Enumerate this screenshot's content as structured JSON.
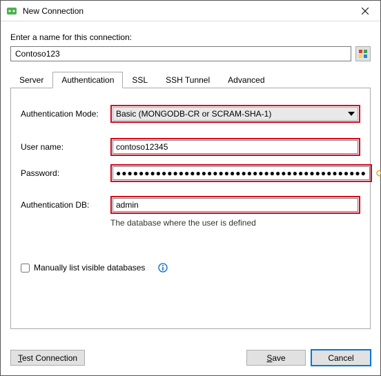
{
  "window": {
    "title": "New Connection"
  },
  "prompt": "Enter a name for this connection:",
  "connection_name": "Contoso123",
  "tabs": {
    "server": "Server",
    "authentication": "Authentication",
    "ssl": "SSL",
    "ssh": "SSH Tunnel",
    "advanced": "Advanced"
  },
  "auth": {
    "mode_label": "Authentication Mode:",
    "mode_value": "Basic (MONGODB-CR or SCRAM-SHA-1)",
    "user_label": "User name:",
    "user_value": "contoso12345",
    "password_label": "Password:",
    "password_value": "●●●●●●●●●●●●●●●●●●●●●●●●●●●●●●●●●●●●●●●●●●●●",
    "authdb_label": "Authentication DB:",
    "authdb_value": "admin",
    "authdb_hint": "The database where the user is defined",
    "manual_list_label": "Manually list visible databases",
    "manual_list_checked": false
  },
  "buttons": {
    "test": "Test Connection",
    "save": "Save",
    "cancel": "Cancel"
  }
}
